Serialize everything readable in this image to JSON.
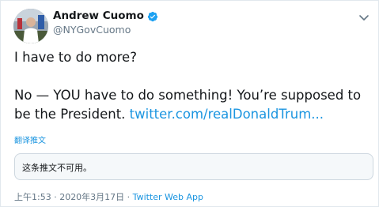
{
  "author": {
    "name": "Andrew Cuomo",
    "handle": "@NYGovCuomo",
    "verified": true
  },
  "tweet": {
    "line1": "I have to do more?",
    "line2": "No — YOU have to do something!  You’re supposed to",
    "line3_text": "be the President. ",
    "line3_link": "twitter.com/realDonaldTrum..."
  },
  "translate_label": "翻译推文",
  "quoted_tweet": {
    "text": "这条推文不可用。"
  },
  "meta": {
    "timestamp": "上午1:53 · 2020年3月17日 · ",
    "source": "Twitter Web App"
  },
  "colors": {
    "link": "#1b95e0",
    "text": "#14171a",
    "secondary": "#657786",
    "border": "#e1e8ed"
  },
  "icons": [
    "avatar-photo",
    "verified-badge-icon",
    "chevron-down-icon"
  ]
}
